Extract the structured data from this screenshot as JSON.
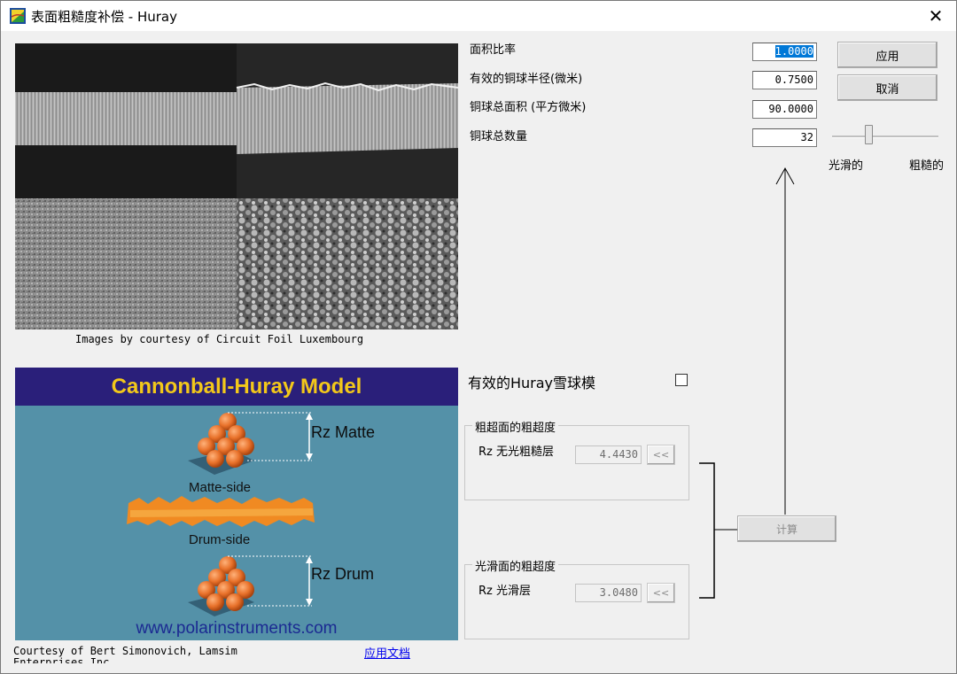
{
  "window": {
    "title": "表面粗糙度补偿 - Huray",
    "close_glyph": "✕"
  },
  "params": {
    "area_ratio_label": "面积比率",
    "area_ratio_value": "1.0000",
    "radius_label": "有效的铜球半径(微米)",
    "radius_value": "0.7500",
    "surface_label": "铜球总面积 (平方微米)",
    "surface_value": "90.0000",
    "count_label": "铜球总数量",
    "count_value": "32"
  },
  "buttons": {
    "apply": "应用",
    "cancel": "取消",
    "calculate": "计算",
    "copy_matte": "<<",
    "copy_drum": "<<"
  },
  "slider": {
    "left_label": "光滑的",
    "right_label": "粗糙的",
    "position": 0.3
  },
  "photo": {
    "caption": "Images by courtesy of Circuit Foil Luxembourg"
  },
  "model_image": {
    "heading": "Cannonball-Huray Model",
    "rz_matte": "Rz Matte",
    "matte_side": "Matte-side",
    "drum_side": "Drum-side",
    "rz_drum": "Rz Drum",
    "url": "www.polarinstruments.com"
  },
  "courtesy": {
    "line1": "Courtesy of Bert Simonovich, Lamsim",
    "line2": "Enterprises Inc."
  },
  "doc_link": "应用文档",
  "huray_checkbox_label": "有效的Huray雪球模",
  "huray_checkbox_checked": false,
  "matte_group": {
    "title": "粗超面的粗超度",
    "label": "Rz  无光粗糙层",
    "value": "4.4430"
  },
  "drum_group": {
    "title": "光滑面的粗超度",
    "label": "Rz  光滑层",
    "value": "3.0480"
  },
  "colors": {
    "selection": "#0078d7",
    "model_bg": "#5491a8",
    "model_header": "#2a1f7a",
    "heading_yellow": "#f3c81a",
    "ball_orange": "#e8712a"
  }
}
